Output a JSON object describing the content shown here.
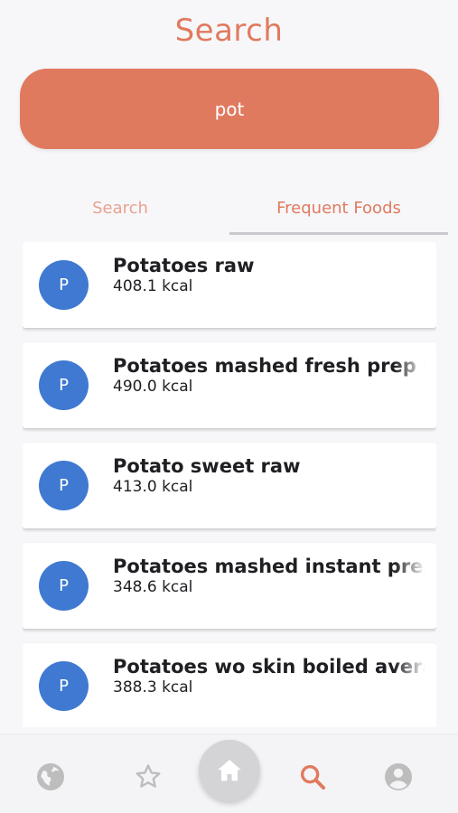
{
  "header": {
    "title": "Search"
  },
  "search": {
    "value": "pot"
  },
  "tabs": [
    {
      "label": "Search",
      "active": false
    },
    {
      "label": "Frequent Foods",
      "active": true
    }
  ],
  "foods": [
    {
      "initial": "P",
      "name": "Potatoes raw",
      "kcal": "408.1 kcal"
    },
    {
      "initial": "P",
      "name": "Potatoes mashed fresh prep w",
      "kcal": "490.0 kcal"
    },
    {
      "initial": "P",
      "name": "Potato sweet raw",
      "kcal": "413.0 kcal"
    },
    {
      "initial": "P",
      "name": "Potatoes mashed instant prep",
      "kcal": "348.6 kcal"
    },
    {
      "initial": "P",
      "name": "Potatoes wo skin boiled averag",
      "kcal": "388.3 kcal"
    }
  ],
  "nav": {
    "items": [
      "globe-icon",
      "star-icon",
      "home-icon",
      "search-icon",
      "account-icon"
    ],
    "active": "search-icon"
  },
  "colors": {
    "accent": "#e07a5f",
    "avatar": "#3f79d1",
    "nav_inactive": "#bdbdbd"
  }
}
